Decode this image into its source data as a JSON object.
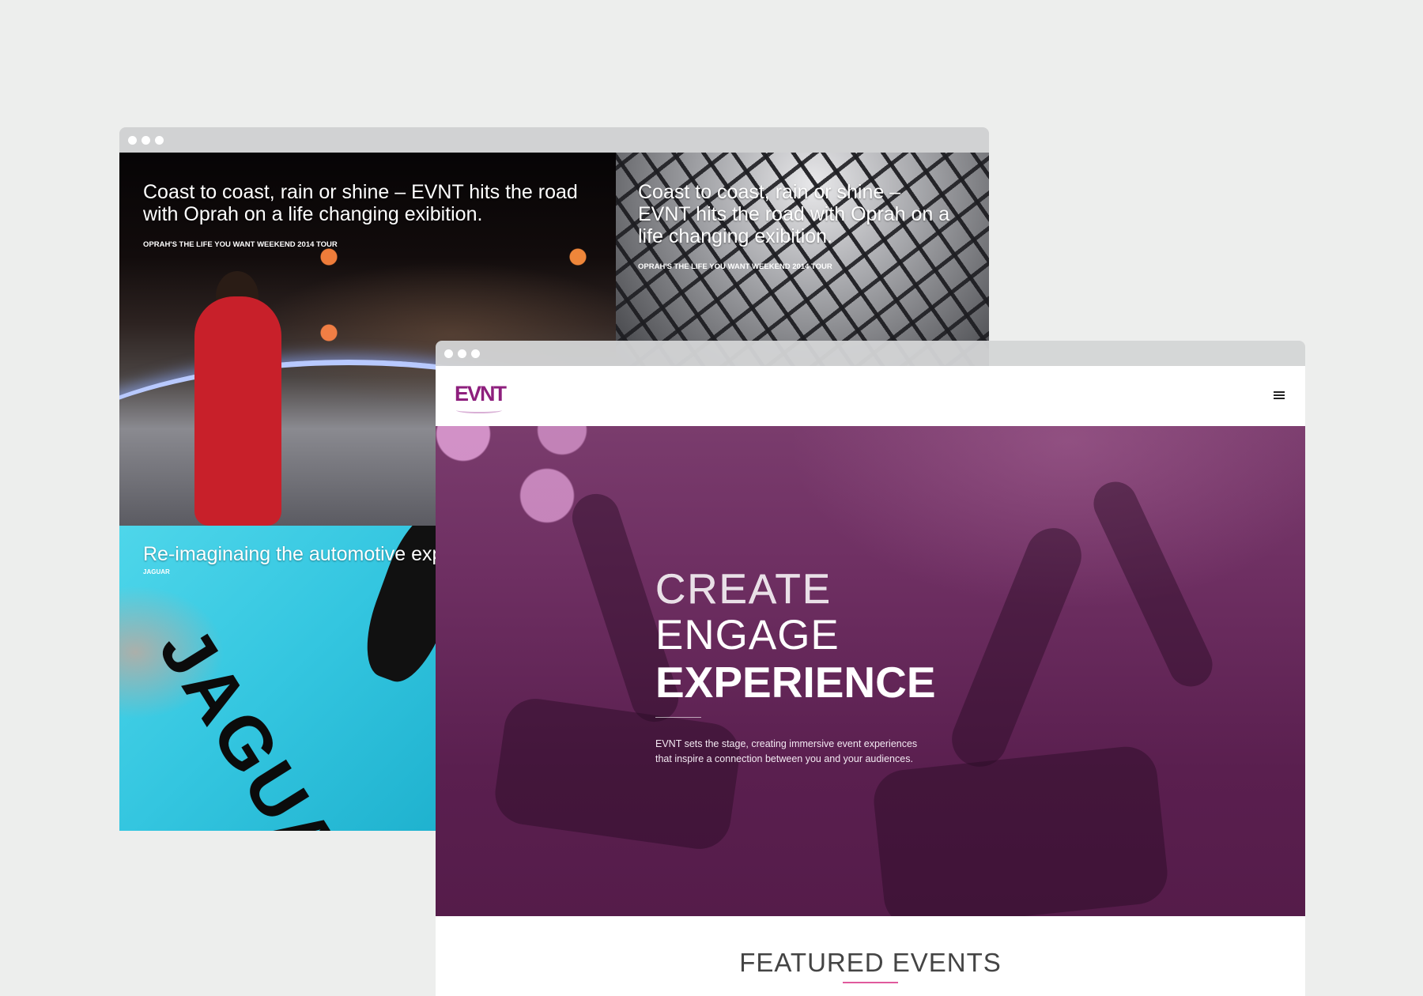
{
  "back_window": {
    "tiles": [
      {
        "title": "Coast to coast, rain or shine – EVNT hits the road with Oprah on a life changing exibition.",
        "subtitle": "OPRAH'S THE LIFE YOU WANT WEEKEND 2014 TOUR"
      },
      {
        "title": "Coast to coast, rain or shine – EVNT hits the road with Oprah on a life changing exibition.",
        "subtitle": "OPRAH'S THE LIFE YOU WANT WEEKEND 2014 TOUR"
      },
      {
        "title": "Re-imaginaing the automotive exp",
        "subtitle": "JAGUAR"
      }
    ],
    "jaguar_lettering": "JAGUAR"
  },
  "front_window": {
    "logo": "EVNT",
    "menu_icon": "hamburger-menu-icon",
    "hero": {
      "line1": "CREATE",
      "line2": "ENGAGE",
      "line3": "EXPERIENCE",
      "description": "EVNT sets the stage, creating immersive event experiences that inspire a connection between you and your audiences."
    },
    "featured_title": "FEATURED EVENTS"
  },
  "colors": {
    "brand": "#8e1f7d",
    "hero_purple": "#5a1f4f",
    "accent_pink": "#e05a9c",
    "page_bg": "#edeeed"
  }
}
